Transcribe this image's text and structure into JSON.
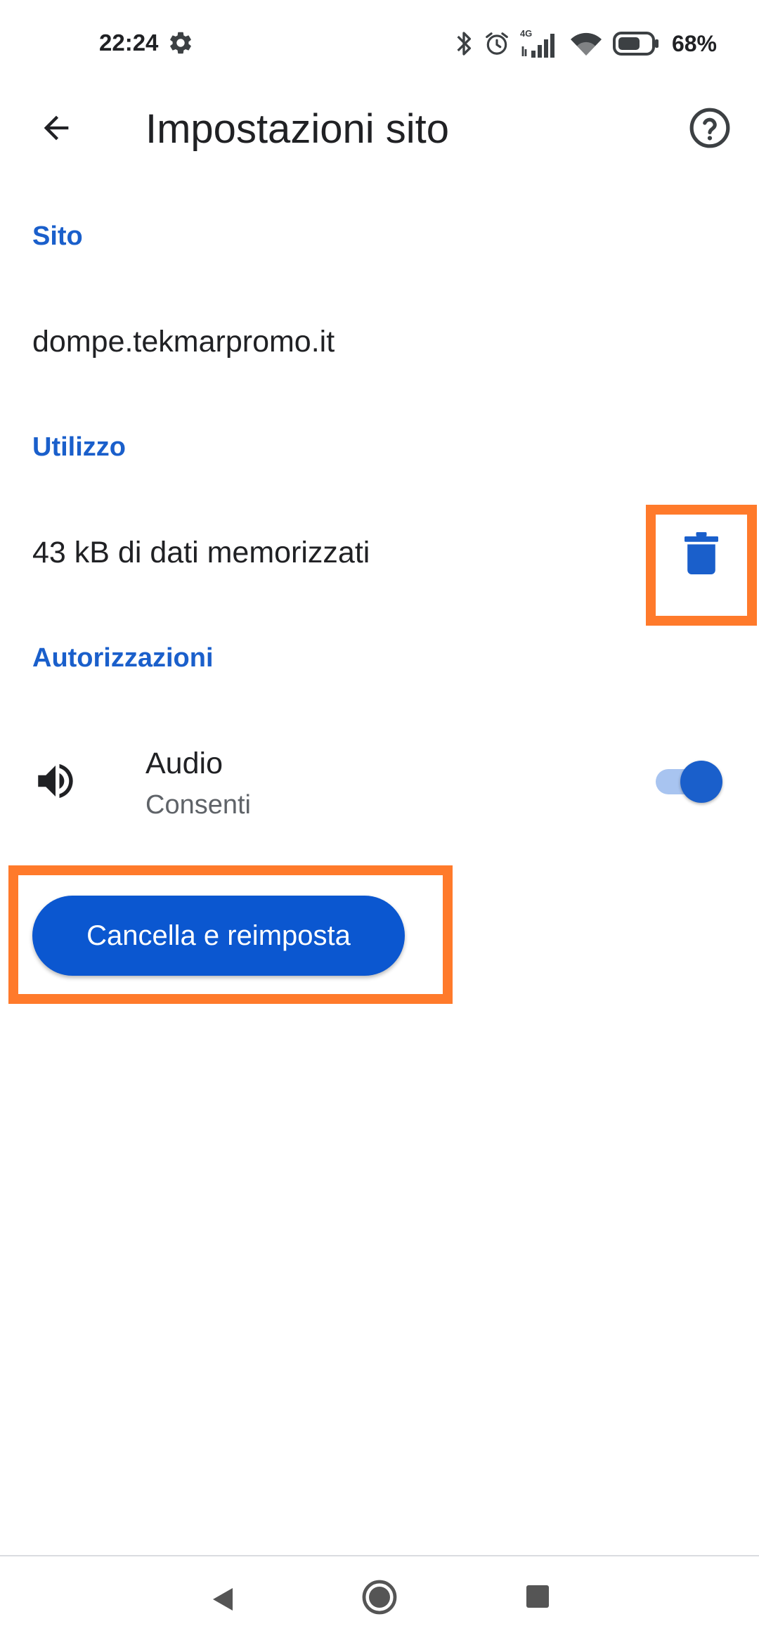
{
  "status_bar": {
    "time": "22:24",
    "network_label": "4G",
    "battery_percent": "68%",
    "battery_level": 0.68,
    "icons": [
      "gear-icon",
      "bluetooth-icon",
      "alarm-icon",
      "signal-icon",
      "wifi-icon",
      "battery-icon"
    ]
  },
  "app_bar": {
    "title": "Impostazioni sito",
    "back_icon": "arrow-back-icon",
    "help_icon": "help-circle-icon"
  },
  "sections": {
    "site": {
      "header": "Sito",
      "value": "dompe.tekmarpromo.it"
    },
    "usage": {
      "header": "Utilizzo",
      "value": "43 kB di dati memorizzati",
      "action_icon": "trash-icon"
    },
    "permissions": {
      "header": "Autorizzazioni",
      "items": [
        {
          "title": "Audio",
          "subtitle": "Consenti",
          "icon": "speaker-icon",
          "enabled": true
        }
      ]
    }
  },
  "reset_button": {
    "label": "Cancella e reimposta"
  },
  "colors": {
    "accent": "#1a5fcb",
    "button": "#0b57d0",
    "highlight": "#ff7a2b",
    "toggle_track": "#a8c4f0"
  },
  "nav_bar": {
    "icons": [
      "nav-back-icon",
      "nav-home-icon",
      "nav-recents-icon"
    ]
  }
}
